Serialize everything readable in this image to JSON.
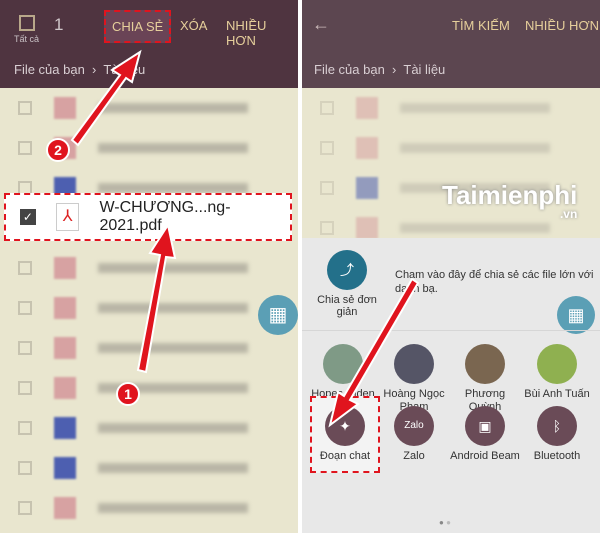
{
  "left": {
    "select_all": "Tất cả",
    "count": "1",
    "share": "CHIA SẺ",
    "delete": "XÓA",
    "more": "NHIỀU HƠN",
    "breadcrumb_root": "File của bạn",
    "breadcrumb_current": "Tài liệu",
    "selected_file": "W-CHƯƠNG...ng-2021.pdf"
  },
  "right": {
    "search": "TÌM KIẾM",
    "more": "NHIỀU HƠN",
    "breadcrumb_root": "File của bạn",
    "breadcrumb_current": "Tài liệu",
    "watermark": "Taimienphi",
    "watermark_sub": ".vn",
    "simple_share": "Chia sẻ đơn giản",
    "hint": "Chạm vào đây để chia sẻ các file lớn với danh bạ.",
    "contacts": [
      {
        "name": "Hopes Hiden"
      },
      {
        "name": "Hoàng Ngọc Phạm"
      },
      {
        "name": "Phương Quỳnh"
      },
      {
        "name": "Bùi Anh Tuấn"
      }
    ],
    "apps": [
      {
        "name": "Đoạn chat",
        "icon": "messenger-icon"
      },
      {
        "name": "Zalo",
        "icon": "zalo-icon"
      },
      {
        "name": "Android Beam",
        "icon": "android-beam-icon"
      },
      {
        "name": "Bluetooth",
        "icon": "bluetooth-icon"
      }
    ]
  },
  "steps": [
    "1",
    "2"
  ],
  "colors": {
    "header": "#4f3440",
    "accent": "#e6cf9b",
    "highlight": "#e0141e",
    "fab": "#5b9fb5"
  }
}
